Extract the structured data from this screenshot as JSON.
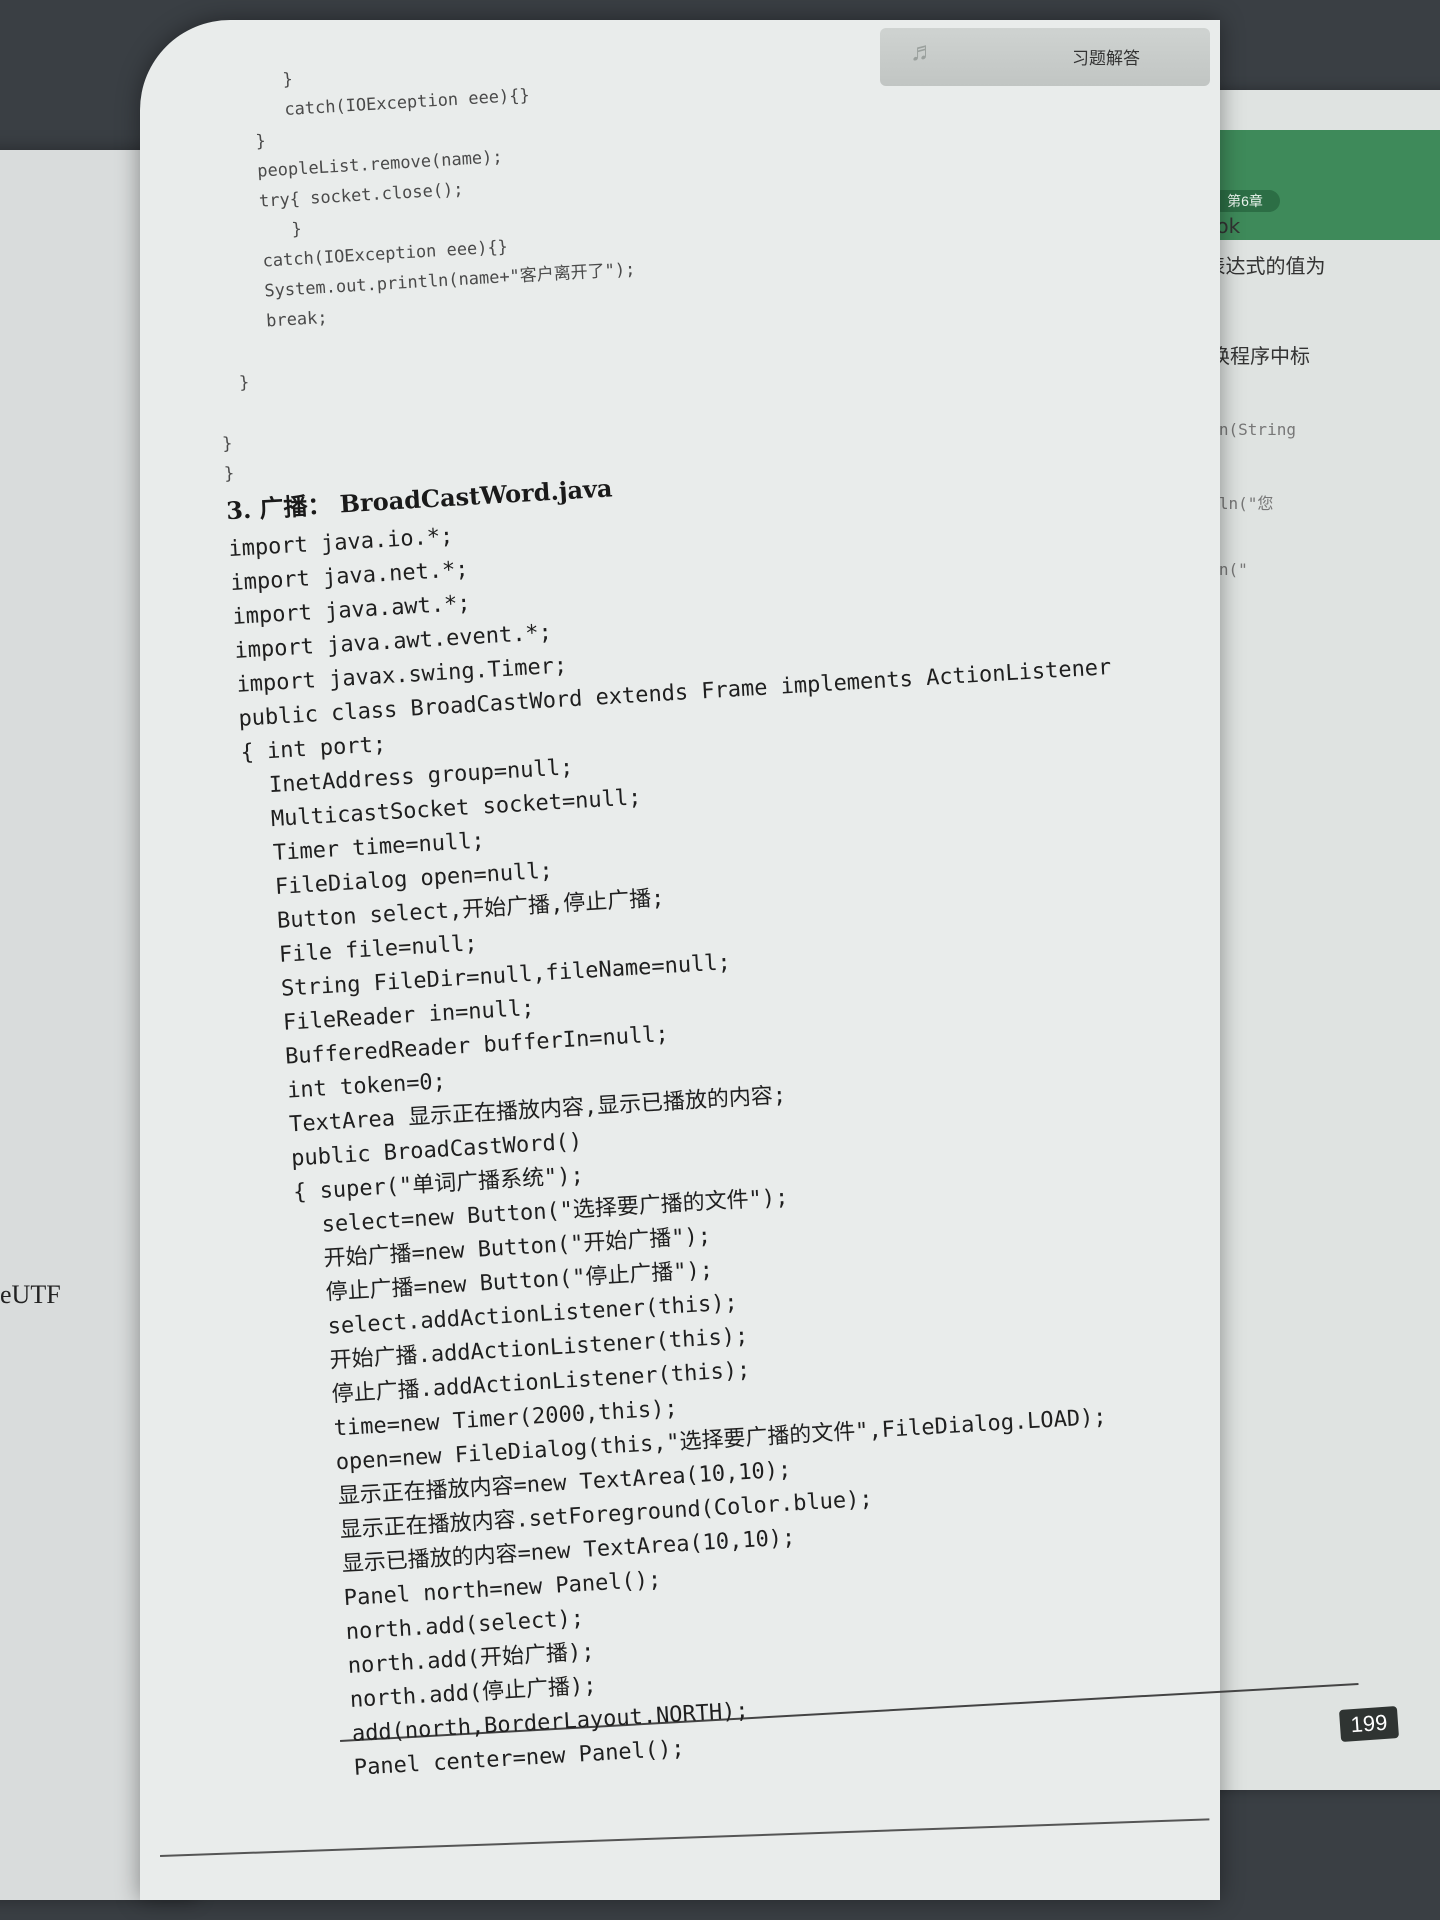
{
  "left_page": {
    "fragment": "eUTF"
  },
  "right_page": {
    "lines": [
      "是 ok",
      "\",表达式的值为",
      "替换程序中标",
      "main(String",
      "intln(\"您",
      "ntln(\""
    ]
  },
  "header": {
    "title": "习题解答"
  },
  "code_top": [
    "        }",
    "        catch(IOException eee){}",
    "     }",
    "     peopleList.remove(name);",
    "     try{ socket.close();",
    "        }",
    "     catch(IOException eee){}",
    "     System.out.println(name+\"客户离开了\");",
    "     break;",
    "",
    "  }",
    "",
    "}",
    "}"
  ],
  "section": {
    "number": "3.",
    "label": "广播：",
    "file": "BroadCastWord.java"
  },
  "code_main": [
    "import java.io.*;",
    "import java.net.*;",
    "import java.awt.*;",
    "import java.awt.event.*;",
    "import javax.swing.Timer;",
    "public class BroadCastWord extends Frame implements ActionListener",
    "{ int port;",
    "  InetAddress group=null;",
    "  MulticastSocket socket=null;",
    "  Timer time=null;",
    "  FileDialog open=null;",
    "  Button select,开始广播,停止广播;",
    "  File file=null;",
    "  String FileDir=null,fileName=null;",
    "  FileReader in=null;",
    "  BufferedReader bufferIn=null;",
    "  int token=0;",
    "  TextArea 显示正在播放内容,显示已播放的内容;",
    "  public BroadCastWord()",
    "  { super(\"单词广播系统\");",
    "    select=new Button(\"选择要广播的文件\");",
    "    开始广播=new Button(\"开始广播\");",
    "    停止广播=new Button(\"停止广播\");",
    "    select.addActionListener(this);",
    "    开始广播.addActionListener(this);",
    "    停止广播.addActionListener(this);",
    "    time=new Timer(2000,this);",
    "    open=new FileDialog(this,\"选择要广播的文件\",FileDialog.LOAD);",
    "    显示正在播放内容=new TextArea(10,10);",
    "    显示正在播放内容.setForeground(Color.blue);",
    "    显示已播放的内容=new TextArea(10,10);",
    "    Panel north=new Panel();",
    "    north.add(select);",
    "    north.add(开始广播);",
    "    north.add(停止广播);",
    "    add(north,BorderLayout.NORTH);",
    "    Panel center=new Panel();"
  ],
  "page_number": "199"
}
